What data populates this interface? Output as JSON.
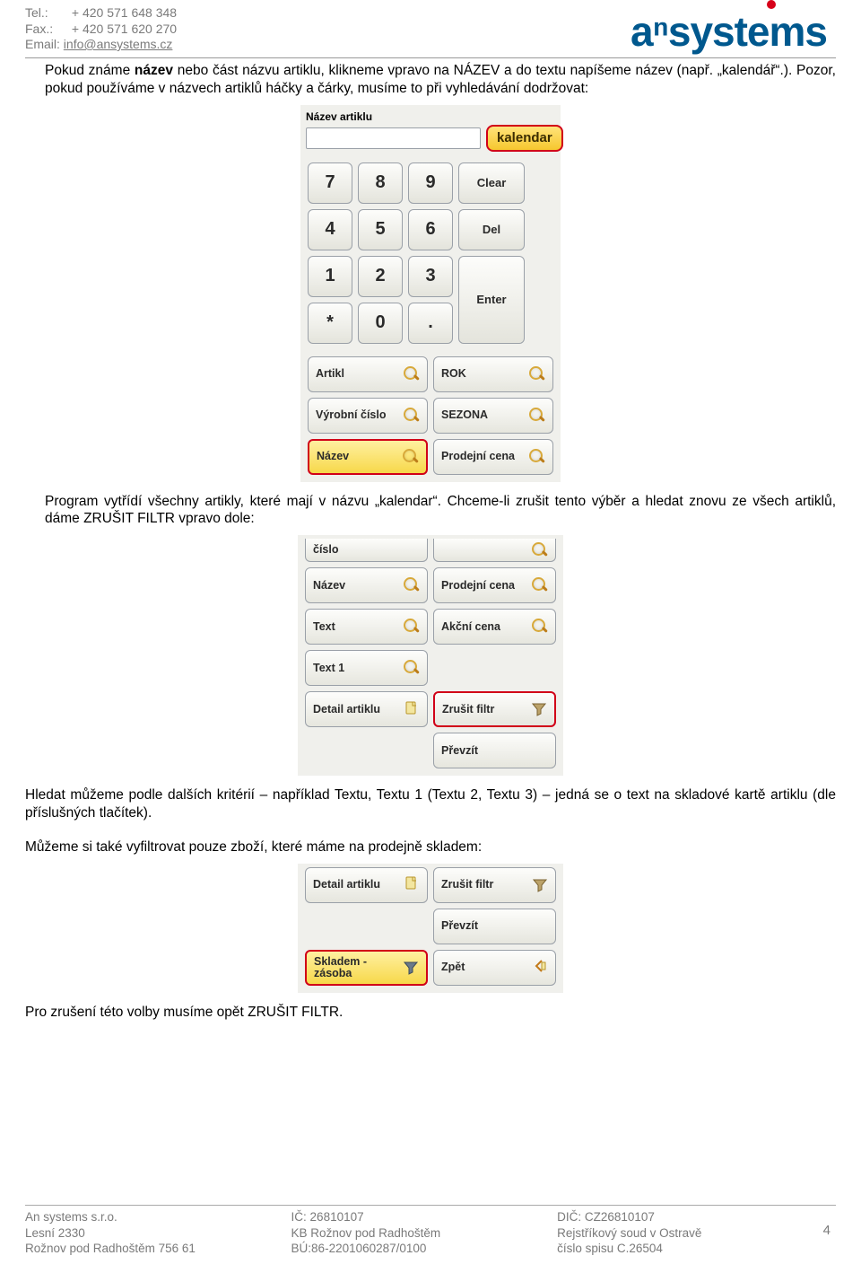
{
  "header": {
    "tel_label": "Tel.:",
    "tel": "+ 420 571 648 348",
    "fax_label": "Fax.:",
    "fax": "+ 420 571 620 270",
    "email_label": "Email:",
    "email": "info@ansystems.cz",
    "logo_text": "aⁿsystems"
  },
  "para1": "Pokud známe název nebo část názvu artiklu, klikneme vpravo na NÁZEV a do textu napíšeme název (např. „kalendář“.). Pozor, pokud používáme v názvech artiklů háčky a čárky, musíme to při vyhledávání dodržovat:",
  "panel1": {
    "field_label": "Název artiklu",
    "input_value": "",
    "search_value": "kalendar",
    "keys": [
      "7",
      "8",
      "9",
      "Clear",
      "4",
      "5",
      "6",
      "Del",
      "1",
      "2",
      "3",
      "Enter",
      "*",
      "0",
      "."
    ],
    "filters_left": [
      "Artikl",
      "Výrobní číslo",
      "Název"
    ],
    "filters_right": [
      "ROK",
      "SEZONA",
      "Prodejní cena"
    ]
  },
  "para2": "Program vytřídí všechny artikly, které mají v názvu „kalendar“. Chceme-li zrušit tento výběr a hledat znovu ze všech artiklů, dáme ZRUŠIT FILTR vpravo dole:",
  "panel2": {
    "half_top_left": "číslo",
    "half_top_right_partial": "",
    "left": [
      "Název",
      "Text",
      "Text 1",
      "Detail artiklu"
    ],
    "right": [
      "Prodejní cena",
      "Akční cena",
      "",
      "Zrušit filtr",
      "Převzít"
    ]
  },
  "para3": "Hledat můžeme podle dalších kritérií – například Textu, Textu 1 (Textu 2, Textu 3) – jedná se o text na skladové kartě artiklu (dle příslušných tlačítek).",
  "para4": "Můžeme si také vyfiltrovat pouze zboží, které máme na prodejně skladem:",
  "panel3": {
    "left": [
      "Detail artiklu",
      "",
      "Skladem - zásoba"
    ],
    "right": [
      "Zrušit filtr",
      "Převzít",
      "Zpět"
    ]
  },
  "para5": "Pro zrušení této volby musíme opět ZRUŠIT FILTR.",
  "footer": {
    "col1": [
      "An systems s.r.o.",
      "Lesní 2330",
      "Rožnov pod Radhoštěm 756 61"
    ],
    "col2": [
      "IČ: 26810107",
      "KB Rožnov pod Radhoštěm",
      "BÚ:86-2201060287/0100"
    ],
    "col3": [
      "DIČ: CZ26810107",
      "Rejstříkový soud v Ostravě",
      "číslo spisu C.26504"
    ],
    "page": "4"
  }
}
